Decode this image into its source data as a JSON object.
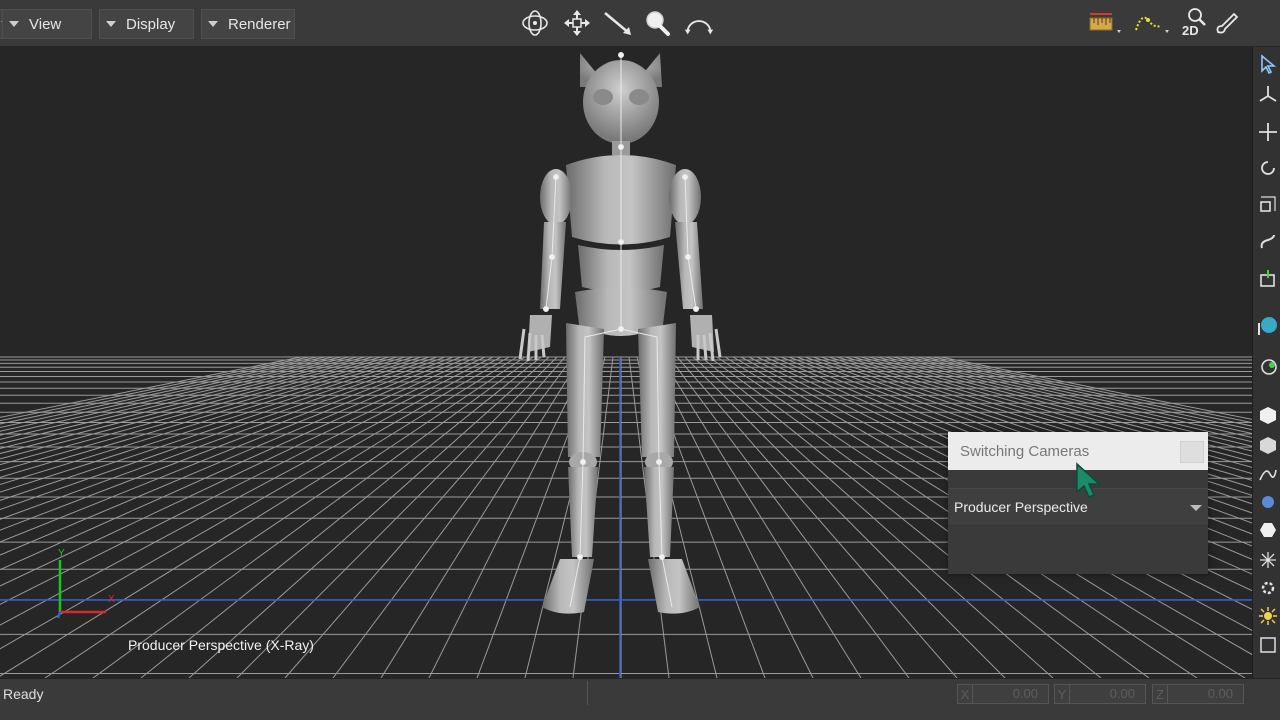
{
  "menu": {
    "first_label": "",
    "view_label": "View",
    "display_label": "Display",
    "renderer_label": "Renderer"
  },
  "toolbar_center": [
    "orbit-icon",
    "pan-icon",
    "dolly-icon",
    "zoom-icon",
    "rotate-view-icon"
  ],
  "toolbar_right": [
    "ruler-icon",
    "path-icon",
    "2d-view-icon",
    "brush-icon"
  ],
  "toolbar_right_text": {
    "two_d": "2D"
  },
  "right_column": [
    "select-arrow-icon",
    "transform-icon",
    "move-icon",
    "rotate-icon",
    "scale-icon",
    "link-icon",
    "pivot-icon",
    "camera-icon",
    "mirror-icon",
    "cube-icon",
    "box-icon",
    "spline-icon",
    "sphere-icon",
    "hexagon-icon",
    "bone-icon",
    "gear-icon",
    "sun-icon",
    "frame-icon"
  ],
  "viewport": {
    "label": "Producer Perspective (X-Ray)",
    "axes": {
      "y": "Y",
      "x": "X"
    },
    "colors": {
      "grid": "#9a9a9a",
      "background": "#262626",
      "blue_line": "#2f5fd8",
      "axis_y": "#1ec41e",
      "axis_x": "#d82a2a"
    }
  },
  "dialog": {
    "title": "Switching Cameras",
    "selected_camera": "Producer Perspective"
  },
  "status": {
    "text": "Ready",
    "coords": [
      {
        "axis": "X",
        "value": "0.00"
      },
      {
        "axis": "Y",
        "value": "0.00"
      },
      {
        "axis": "Z",
        "value": "0.00"
      }
    ]
  }
}
